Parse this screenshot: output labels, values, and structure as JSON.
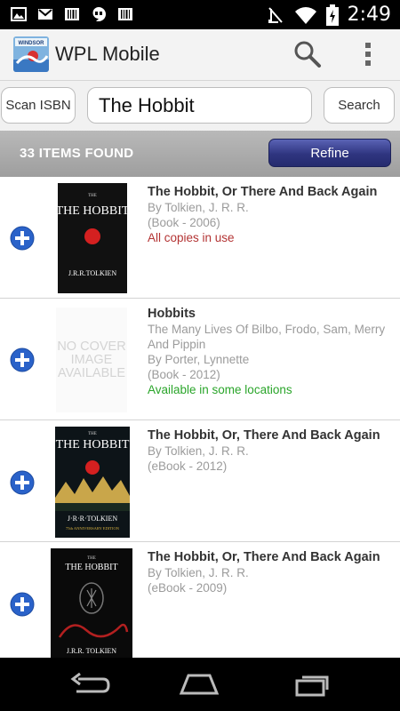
{
  "status_bar": {
    "time": "2:49",
    "icons": [
      "image-notification-icon",
      "gmail-icon",
      "barcode-icon",
      "hangouts-icon",
      "barcode-icon",
      "mute-icon",
      "wifi-icon",
      "battery-charging-icon"
    ]
  },
  "app": {
    "title": "WPL Mobile",
    "logo_text": "WINDSOR PUBLIC LIBRARY"
  },
  "search": {
    "scan_label": "Scan ISBN",
    "query": "The Hobbit",
    "search_label": "Search"
  },
  "results": {
    "count_label": "33 ITEMS FOUND",
    "refine_label": "Refine",
    "items": [
      {
        "title": "The Hobbit, Or There And Back Again",
        "author": "By Tolkien, J. R. R.",
        "format": "(Book - 2006)",
        "status": "All copies in use",
        "cover": {
          "title": "THE HOBBIT",
          "author": "J.R.R.TOLKIEN"
        }
      },
      {
        "title": "Hobbits",
        "subtitle": "The Many Lives Of Bilbo, Frodo, Sam, Merry And Pippin",
        "author": "By Porter, Lynnette",
        "format": "(Book - 2012)",
        "status": "Available in some locations",
        "cover": {
          "placeholder": "NO COVER IMAGE AVAILABLE"
        }
      },
      {
        "title": "The Hobbit, Or, There And Back Again",
        "author": "By Tolkien, J. R. R.",
        "format": "(eBook - 2012)",
        "cover": {
          "title": "THE HOBBIT",
          "author": "J·R·R·TOLKIEN",
          "edition": "75th ANNIVERSARY EDITION"
        }
      },
      {
        "title": "The Hobbit, Or, There And Back Again",
        "author": "By Tolkien, J. R. R.",
        "format": "(eBook - 2009)",
        "cover": {
          "title": "THE HOBBIT",
          "author": "J.R.R. TOLKIEN"
        }
      }
    ]
  },
  "nav": {
    "icons": [
      "back-icon",
      "home-icon",
      "recent-apps-icon"
    ]
  },
  "colors": {
    "refine": "#2f3580",
    "add": "#2a62c9",
    "unavailable": "#b33333",
    "available": "#2aa52a"
  }
}
